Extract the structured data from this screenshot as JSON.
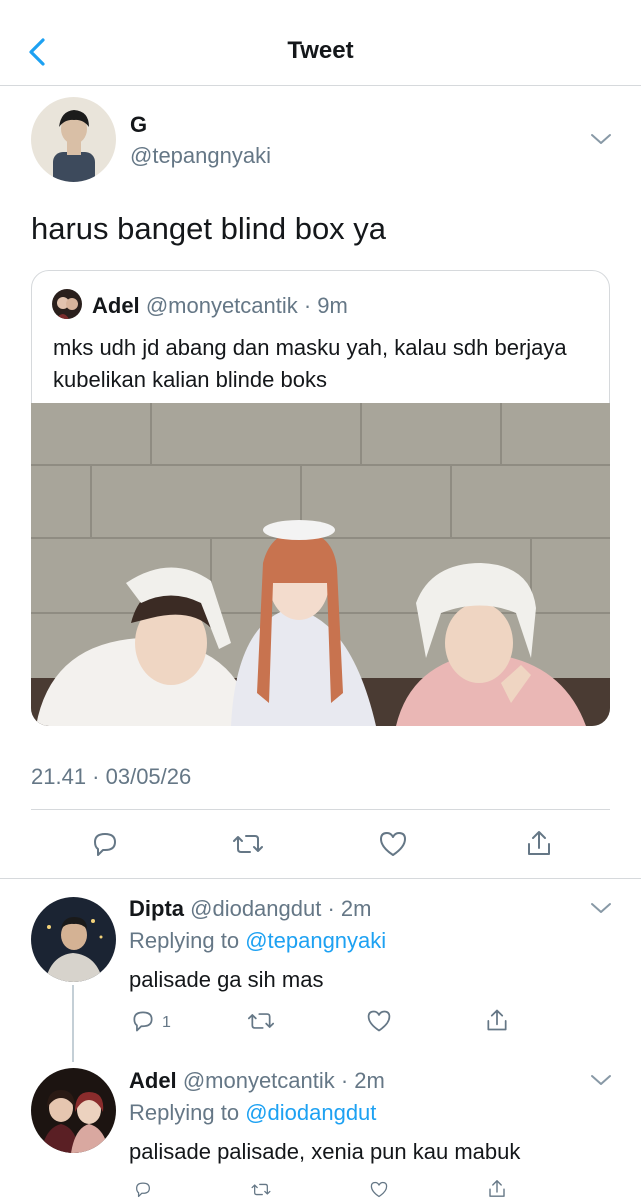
{
  "nav": {
    "title": "Tweet",
    "back_icon": "chevron-left-icon",
    "accent": "#1da1f2"
  },
  "tweet": {
    "name": "G",
    "handle": "@tepangnyaki",
    "text": "harus banget blind box ya",
    "timestamp": "21.41 · 03/05/26",
    "quote": {
      "name": "Adel",
      "handle_time": "@monyetcantik · 9m",
      "text": "mks udh jd abang dan masku yah, kalau sdh berjaya kubelikan kalian blinde boks"
    },
    "actions": [
      "reply-icon",
      "retweet-icon",
      "like-icon",
      "share-icon"
    ]
  },
  "replies": [
    {
      "name": "Dipta",
      "handle_time": "@diodangdut · 2m",
      "replying_label": "Replying to ",
      "replying_to": "@tepangnyaki",
      "text": "palisade ga sih mas",
      "reply_count": "1"
    },
    {
      "name": "Adel",
      "handle_time": "@monyetcantik · 2m",
      "replying_label": "Replying to ",
      "replying_to": "@diodangdut",
      "text": "palisade palisade, xenia pun kau mabuk"
    }
  ]
}
